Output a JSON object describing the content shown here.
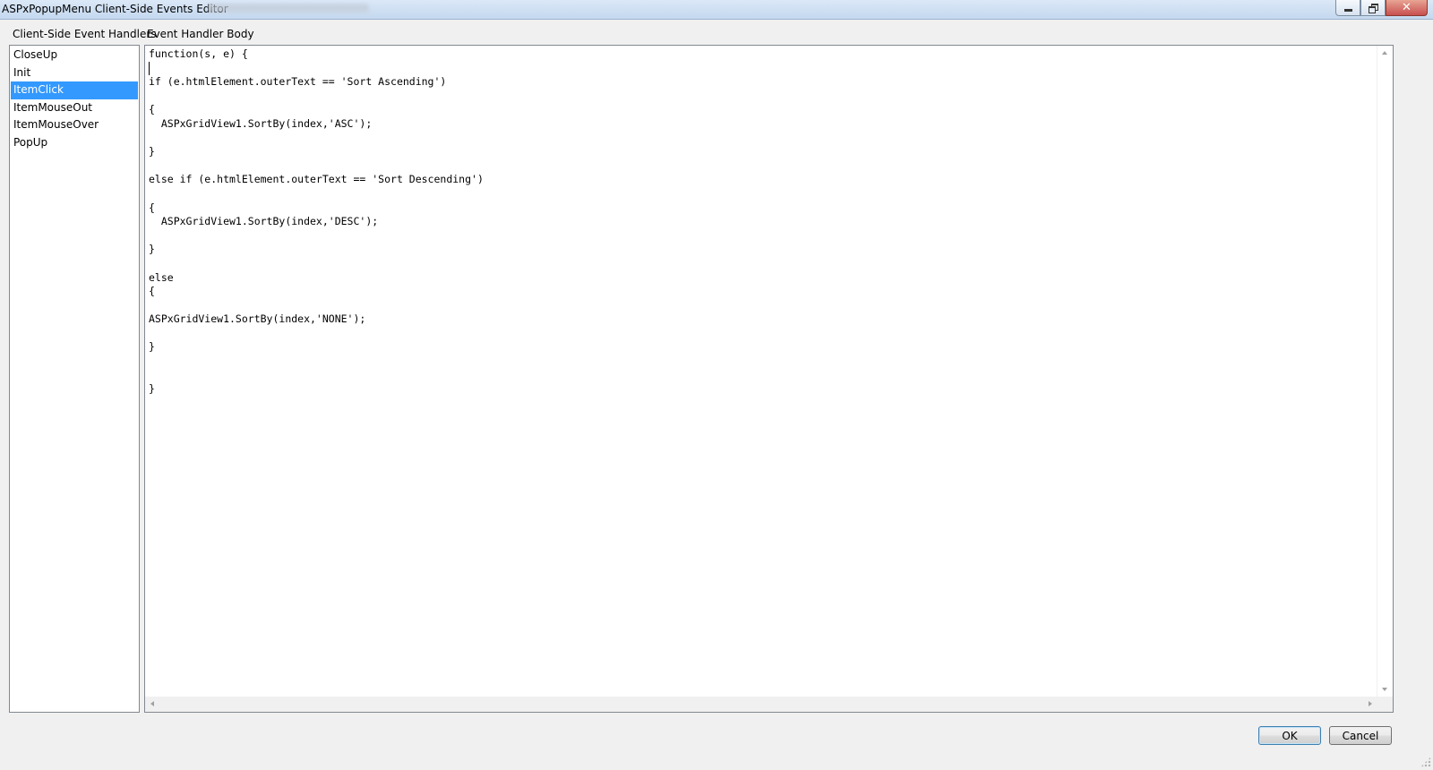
{
  "window": {
    "title": "ASPxPopupMenu Client-Side Events Editor",
    "controls": {
      "minimize": "minimize",
      "maximize": "restore",
      "close": "close"
    }
  },
  "headers": {
    "left": "Client-Side Event Handlers",
    "right": "Event Handler Body"
  },
  "handlers": {
    "selected": "ItemClick",
    "items": [
      "CloseUp",
      "Init",
      "ItemClick",
      "ItemMouseOut",
      "ItemMouseOver",
      "PopUp"
    ]
  },
  "editor": {
    "code": "function(s, e) {\n\nif (e.htmlElement.outerText == 'Sort Ascending')\n\n{\n  ASPxGridView1.SortBy(index,'ASC');\n\n}\n\nelse if (e.htmlElement.outerText == 'Sort Descending')\n\n{\n  ASPxGridView1.SortBy(index,'DESC');\n\n}\n\nelse\n{\n\nASPxGridView1.SortBy(index,'NONE');\n\n}\n\n\n}"
  },
  "buttons": {
    "ok": "OK",
    "cancel": "Cancel"
  },
  "colors": {
    "selection": "#3399ff",
    "titlebar": "#c4d8ef",
    "close_button": "#c75050"
  },
  "icons": [
    "minimize-icon",
    "restore-icon",
    "close-icon",
    "scroll-up-icon",
    "scroll-down-icon",
    "scroll-left-icon",
    "scroll-right-icon",
    "resize-grip-icon"
  ]
}
